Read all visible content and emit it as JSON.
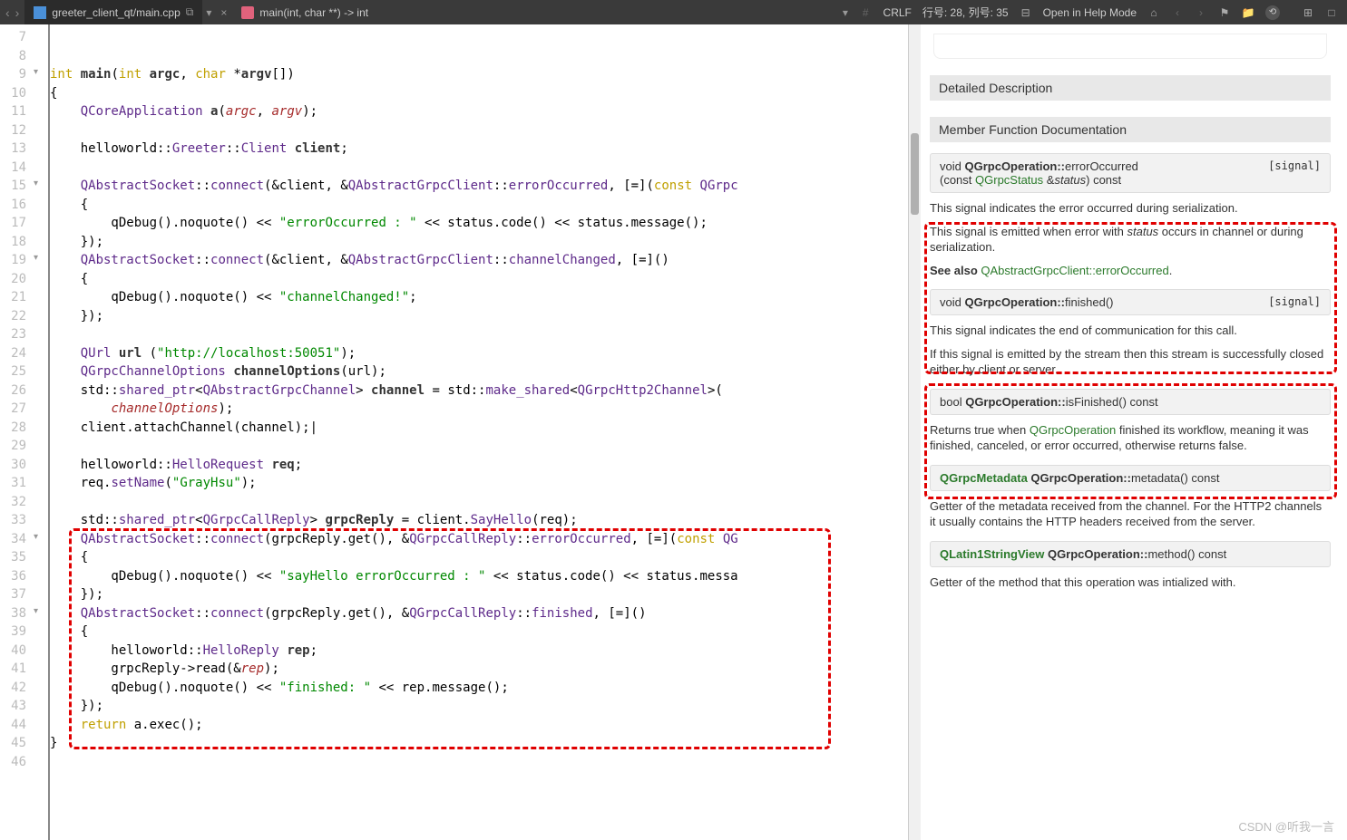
{
  "titlebar": {
    "file_tab": "greeter_client_qt/main.cpp",
    "method_tab": "main(int, char **) -> int",
    "crlf": "CRLF",
    "pos": "行号: 28, 列号: 35",
    "help": "Open in Help Mode"
  },
  "gutter": {
    "start": 7,
    "end": 46
  },
  "fold_marks": [
    9,
    15,
    19,
    34,
    38
  ],
  "code_lines": {
    "7": "",
    "8": "",
    "9": {
      "raw": "int main(int argc, char *argv[])",
      "tokens": [
        [
          "kw",
          "int"
        ],
        [
          "",
          ""
        ],
        [
          "fn",
          " main"
        ],
        [
          "",
          "("
        ],
        [
          "kw",
          "int"
        ],
        [
          "",
          " "
        ],
        [
          "fn",
          "argc"
        ],
        [
          "",
          ", "
        ],
        [
          "kw",
          "char"
        ],
        [
          "",
          " *"
        ],
        [
          "fn",
          "argv"
        ],
        [
          "",
          "[])"
        ]
      ]
    },
    "10": "{",
    "11": {
      "tokens": [
        [
          "",
          "    "
        ],
        [
          "cls",
          "QCoreApplication"
        ],
        [
          "",
          " "
        ],
        [
          "fn",
          "a"
        ],
        [
          "",
          "("
        ],
        [
          "id",
          "argc"
        ],
        [
          "",
          ", "
        ],
        [
          "id",
          "argv"
        ],
        [
          "",
          ");"
        ]
      ]
    },
    "12": "",
    "13": {
      "tokens": [
        [
          "",
          "    helloworld::"
        ],
        [
          "cls",
          "Greeter"
        ],
        [
          "",
          "::"
        ],
        [
          "cls",
          "Client"
        ],
        [
          "",
          " "
        ],
        [
          "fn",
          "client"
        ],
        [
          "",
          ";"
        ]
      ]
    },
    "14": "",
    "15": {
      "tokens": [
        [
          "",
          "    "
        ],
        [
          "cls",
          "QAbstractSocket"
        ],
        [
          "",
          "::"
        ],
        [
          "cls",
          "connect"
        ],
        [
          "",
          "(&client, &"
        ],
        [
          "cls",
          "QAbstractGrpcClient"
        ],
        [
          "",
          "::"
        ],
        [
          "cls",
          "errorOccurred"
        ],
        [
          "",
          ", [=]("
        ],
        [
          "kw",
          "const"
        ],
        [
          "",
          " "
        ],
        [
          "cls",
          "QGrpc"
        ]
      ]
    },
    "16": "    {",
    "17": {
      "tokens": [
        [
          "",
          "        qDebug().noquote() << "
        ],
        [
          "str",
          "\"errorOccurred : \""
        ],
        [
          "",
          " << status.code() << status.message();"
        ]
      ]
    },
    "18": "    });",
    "19": {
      "tokens": [
        [
          "",
          "    "
        ],
        [
          "cls",
          "QAbstractSocket"
        ],
        [
          "",
          "::"
        ],
        [
          "cls",
          "connect"
        ],
        [
          "",
          "(&client, &"
        ],
        [
          "cls",
          "QAbstractGrpcClient"
        ],
        [
          "",
          "::"
        ],
        [
          "cls",
          "channelChanged"
        ],
        [
          "",
          ", [=]()"
        ]
      ]
    },
    "20": "    {",
    "21": {
      "tokens": [
        [
          "",
          "        qDebug().noquote() << "
        ],
        [
          "str",
          "\"channelChanged!\""
        ],
        [
          "",
          ";"
        ]
      ]
    },
    "22": "    });",
    "23": "",
    "24": {
      "tokens": [
        [
          "",
          "    "
        ],
        [
          "cls",
          "QUrl"
        ],
        [
          "",
          " "
        ],
        [
          "fn",
          "url"
        ],
        [
          "",
          " ("
        ],
        [
          "str",
          "\"http://localhost:50051\""
        ],
        [
          "",
          ");"
        ]
      ]
    },
    "25": {
      "tokens": [
        [
          "",
          "    "
        ],
        [
          "cls",
          "QGrpcChannelOptions"
        ],
        [
          "",
          " "
        ],
        [
          "fn",
          "channelOptions"
        ],
        [
          "",
          "(url);"
        ]
      ]
    },
    "26": {
      "tokens": [
        [
          "",
          "    std::"
        ],
        [
          "cls",
          "shared_ptr"
        ],
        [
          "",
          "<"
        ],
        [
          "cls",
          "QAbstractGrpcChannel"
        ],
        [
          "",
          "> "
        ],
        [
          "fn",
          "channel"
        ],
        [
          "",
          " = std::"
        ],
        [
          "cls",
          "make_shared"
        ],
        [
          "",
          "<"
        ],
        [
          "cls",
          "QGrpcHttp2Channel"
        ],
        [
          "",
          ">("
        ]
      ]
    },
    "27": {
      "tokens": [
        [
          "",
          "        "
        ],
        [
          "id",
          "channelOptions"
        ],
        [
          "",
          ");"
        ]
      ]
    },
    "28": {
      "tokens": [
        [
          "",
          "    client.attachChannel(channel);|"
        ]
      ]
    },
    "29": "",
    "30": {
      "tokens": [
        [
          "",
          "    helloworld::"
        ],
        [
          "cls",
          "HelloRequest"
        ],
        [
          "",
          " "
        ],
        [
          "fn",
          "req"
        ],
        [
          "",
          ";"
        ]
      ]
    },
    "31": {
      "tokens": [
        [
          "",
          "    req."
        ],
        [
          "cls",
          "setName"
        ],
        [
          "",
          "("
        ],
        [
          "str",
          "\"GrayHsu\""
        ],
        [
          "",
          ");"
        ]
      ]
    },
    "32": "",
    "33": {
      "tokens": [
        [
          "",
          "    std::"
        ],
        [
          "cls",
          "shared_ptr"
        ],
        [
          "",
          "<"
        ],
        [
          "cls",
          "QGrpcCallReply"
        ],
        [
          "",
          "> "
        ],
        [
          "fn",
          "grpcReply"
        ],
        [
          "",
          " = client."
        ],
        [
          "cls",
          "SayHello"
        ],
        [
          "",
          "(req);"
        ]
      ]
    },
    "34": {
      "tokens": [
        [
          "",
          "    "
        ],
        [
          "cls",
          "QAbstractSocket"
        ],
        [
          "",
          "::"
        ],
        [
          "cls",
          "connect"
        ],
        [
          "",
          "(grpcReply.get(), &"
        ],
        [
          "cls",
          "QGrpcCallReply"
        ],
        [
          "",
          "::"
        ],
        [
          "cls",
          "errorOccurred"
        ],
        [
          "",
          ", [=]("
        ],
        [
          "kw",
          "const"
        ],
        [
          "",
          " "
        ],
        [
          "cls",
          "QG"
        ]
      ]
    },
    "35": "    {",
    "36": {
      "tokens": [
        [
          "",
          "        qDebug().noquote() << "
        ],
        [
          "str",
          "\"sayHello errorOccurred : \""
        ],
        [
          "",
          " << status.code() << status.messa"
        ]
      ]
    },
    "37": "    });",
    "38": {
      "tokens": [
        [
          "",
          "    "
        ],
        [
          "cls",
          "QAbstractSocket"
        ],
        [
          "",
          "::"
        ],
        [
          "cls",
          "connect"
        ],
        [
          "",
          "(grpcReply.get(), &"
        ],
        [
          "cls",
          "QGrpcCallReply"
        ],
        [
          "",
          "::"
        ],
        [
          "cls",
          "finished"
        ],
        [
          "",
          ", [=]()"
        ]
      ]
    },
    "39": "    {",
    "40": {
      "tokens": [
        [
          "",
          "        helloworld::"
        ],
        [
          "cls",
          "HelloReply"
        ],
        [
          "",
          " "
        ],
        [
          "fn",
          "rep"
        ],
        [
          "",
          ";"
        ]
      ]
    },
    "41": {
      "tokens": [
        [
          "",
          "        grpcReply->read(&"
        ],
        [
          "id",
          "rep"
        ],
        [
          "",
          ");"
        ]
      ]
    },
    "42": {
      "tokens": [
        [
          "",
          "        qDebug().noquote() << "
        ],
        [
          "str",
          "\"finished: \""
        ],
        [
          "",
          " << rep.message();"
        ]
      ]
    },
    "43": "    });",
    "44": {
      "tokens": [
        [
          "",
          "    "
        ],
        [
          "kw",
          "return"
        ],
        [
          "",
          " a.exec();"
        ]
      ]
    },
    "45": "}",
    "46": ""
  },
  "doc": {
    "detailed": "Detailed Description",
    "memberfn": "Member Function Documentation",
    "sig1_void": "void",
    "sig1_cls": "QGrpcOperation::",
    "sig1_fn": "errorOccurred",
    "sig1_args_open": "(const ",
    "sig1_args_type": "QGrpcStatus",
    "sig1_args_amp": " &",
    "sig1_args_name": "status",
    "sig1_args_close": ") const",
    "sig1_tag": "[signal]",
    "p1": "This signal indicates the error occurred during serialization.",
    "p2a": "This signal is emitted when error with ",
    "p2b": " occurs in channel or during serialization.",
    "seealso": "See also ",
    "seealso_link": "QAbstractGrpcClient::errorOccurred",
    "sig2_void": "void",
    "sig2_cls": "QGrpcOperation::",
    "sig2_fn": "finished",
    "sig2_args": "()",
    "sig2_tag": "[signal]",
    "p3": "This signal indicates the end of communication for this call.",
    "p4": "If this signal is emitted by the stream then this stream is successfully closed either by client or server.",
    "sig3_ret": "bool",
    "sig3_cls": "QGrpcOperation::",
    "sig3_fn": "isFinished",
    "sig3_args": "() const",
    "p5a": "Returns true when ",
    "p5link": "QGrpcOperation",
    "p5b": " finished its workflow, meaning it was finished, canceled, or error occurred, otherwise returns false.",
    "sig4_ret": "QGrpcMetadata",
    "sig4_cls": " QGrpcOperation::",
    "sig4_fn": "metadata",
    "sig4_args": "() const",
    "p6": "Getter of the metadata received from the channel. For the HTTP2 channels it usually contains the HTTP headers received from the server.",
    "sig5_ret": "QLatin1StringView",
    "sig5_cls": " QGrpcOperation::",
    "sig5_fn": "method",
    "sig5_args": "() const",
    "p7": "Getter of the method that this operation was intialized with."
  },
  "watermark": "CSDN @听我一言"
}
